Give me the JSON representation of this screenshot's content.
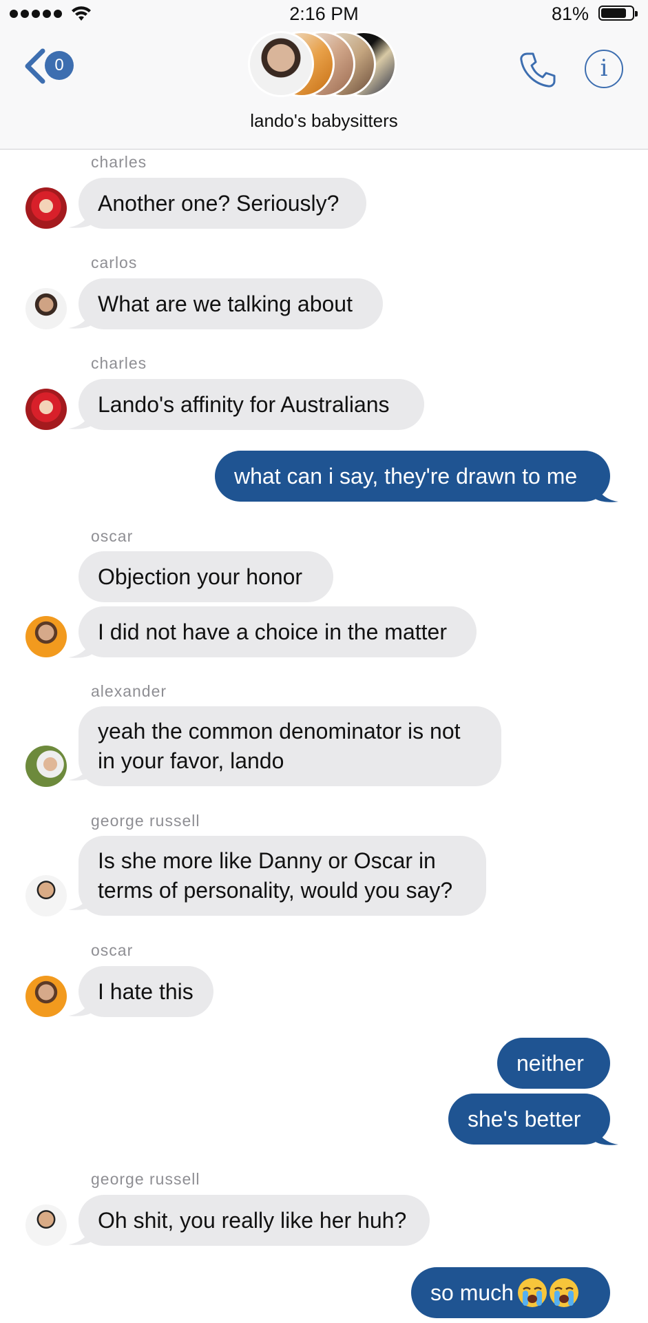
{
  "status_bar": {
    "time": "2:16 PM",
    "battery_percent": "81%",
    "battery_level": 0.81
  },
  "header": {
    "unread_count": "0",
    "group_name": "lando's babysitters"
  },
  "icons": {
    "back": "chevron-left-icon",
    "call": "phone-icon",
    "info": "info-icon",
    "wifi": "wifi-icon"
  },
  "colors": {
    "accent": "#3d6eb0",
    "outgoing_bubble": "#1f5492",
    "incoming_bubble": "#e9e9eb"
  },
  "messages": [
    {
      "sender": "charles",
      "text": "Another one? Seriously?"
    },
    {
      "sender": "carlos",
      "text": "What are we talking about"
    },
    {
      "sender": "charles",
      "text": "Lando's affinity for Australians"
    },
    {
      "sender": "me",
      "text": "what can i say, they're drawn to me"
    },
    {
      "sender": "oscar",
      "text": "Objection your honor"
    },
    {
      "sender": "oscar",
      "text": "I did not have a choice in the matter"
    },
    {
      "sender": "alexander",
      "text": "yeah the common denominator is not in your favor, lando"
    },
    {
      "sender": "george russell",
      "text": "Is she more like Danny or Oscar in terms of personality, would you say?"
    },
    {
      "sender": "oscar",
      "text": "I hate this"
    },
    {
      "sender": "me",
      "text": "neither"
    },
    {
      "sender": "me",
      "text": "she's better"
    },
    {
      "sender": "george russell",
      "text": "Oh shit, you really like her huh?"
    },
    {
      "sender": "me",
      "text": "so much"
    }
  ],
  "emoji_names": [
    "loudly-crying-face-emoji",
    "loudly-crying-face-emoji"
  ]
}
